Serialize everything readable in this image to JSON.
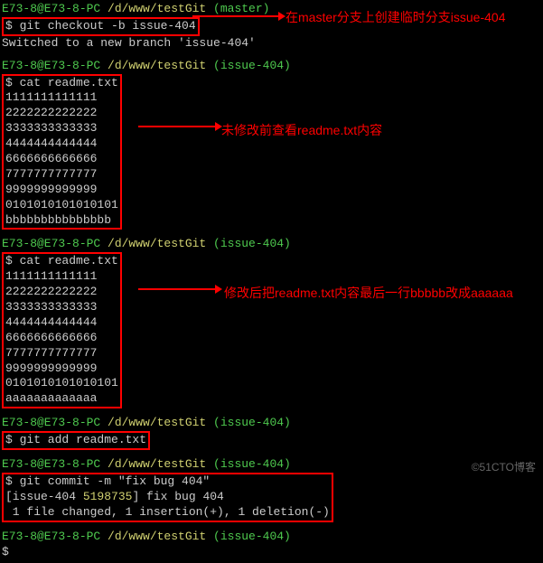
{
  "watermark": "©51CTO博客",
  "annotations": {
    "a1": "在master分支上创建临时分支issue-404",
    "a2": "未修改前查看readme.txt内容",
    "a3": "修改后把readme.txt内容最后一行bbbbb改成aaaaaa"
  },
  "prompt": {
    "user": "E73-8@E73-8-PC",
    "path": " /d/www/testGit ",
    "branch_master": "(master)",
    "branch_issue": "(issue-404)"
  },
  "commands": {
    "checkout": "$ git checkout -b issue-404",
    "cat": "$ cat readme.txt",
    "add": "$ git add readme.txt",
    "commit": "$ git commit -m \"fix bug 404\"",
    "final": "$"
  },
  "output": {
    "switched": "Switched to a new branch 'issue-404'",
    "file_before": {
      "l1": "1111111111111",
      "l2": "2222222222222",
      "l3": "3333333333333",
      "l4": "4444444444444",
      "l5": "6666666666666",
      "l6": "7777777777777",
      "l7": "9999999999999",
      "l8": "0101010101010101",
      "l9": "bbbbbbbbbbbbbbb"
    },
    "file_after": {
      "l1": "1111111111111",
      "l2": "2222222222222",
      "l3": "3333333333333",
      "l4": "4444444444444",
      "l5": "6666666666666",
      "l6": "7777777777777",
      "l7": "9999999999999",
      "l8": "0101010101010101",
      "l9": "aaaaaaaaaaaaa"
    },
    "commit_result": {
      "l1_prefix": "[issue-404 ",
      "l1_hash": "5198735",
      "l1_suffix": "] fix bug 404",
      "l2": " 1 file changed, 1 insertion(+), 1 deletion(-)"
    }
  }
}
